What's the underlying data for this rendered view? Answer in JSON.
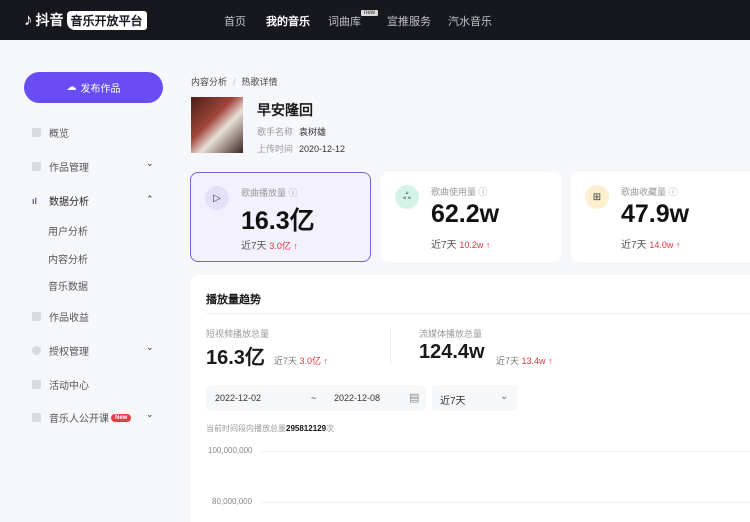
{
  "header": {
    "logo_text": "抖音",
    "logo_tag": "音乐开放平台",
    "nav": [
      "首页",
      "我的音乐",
      "词曲库",
      "宣推服务",
      "汽水音乐"
    ],
    "nav_badge": "new"
  },
  "sidebar": {
    "publish": "发布作品",
    "items": [
      {
        "label": "概览"
      },
      {
        "label": "作品管理"
      },
      {
        "label": "数据分析"
      },
      {
        "label": "用户分析"
      },
      {
        "label": "内容分析"
      },
      {
        "label": "音乐数据"
      },
      {
        "label": "作品收益"
      },
      {
        "label": "授权管理"
      },
      {
        "label": "活动中心"
      },
      {
        "label": "音乐人公开课",
        "badge": "New"
      }
    ]
  },
  "breadcrumb": [
    "内容分析",
    "热歌详情"
  ],
  "song": {
    "title": "早安隆回",
    "singer_label": "歌手名称",
    "singer": "袁树雄",
    "upload_label": "上传时间",
    "upload": "2020-12-12"
  },
  "cards": [
    {
      "label": "歌曲播放量",
      "value": "16.3亿",
      "week_label": "近7天",
      "week": "3.0亿"
    },
    {
      "label": "歌曲使用量",
      "value": "62.2w",
      "week_label": "近7天",
      "week": "10.2w"
    },
    {
      "label": "歌曲收藏量",
      "value": "47.9w",
      "week_label": "近7天",
      "week": "14.0w"
    }
  ],
  "trend": {
    "title": "播放量趋势",
    "short": {
      "label": "短视频播放总量",
      "value": "16.3亿",
      "week_label": "近7天",
      "week": "3.0亿"
    },
    "stream": {
      "label": "流媒体播放总量",
      "value": "124.4w",
      "week_label": "近7天",
      "week": "13.4w"
    },
    "start": "2022-12-02",
    "tilde": "~",
    "end": "2022-12-08",
    "range": "近7天",
    "total_prefix": "当前时间段内播放总量",
    "total": "295812129",
    "total_suffix": "次",
    "y_ticks": [
      "100,000,000",
      "80,000,000"
    ]
  },
  "colors": {
    "accent": "#6a4cf5",
    "up": "#e0333f"
  }
}
